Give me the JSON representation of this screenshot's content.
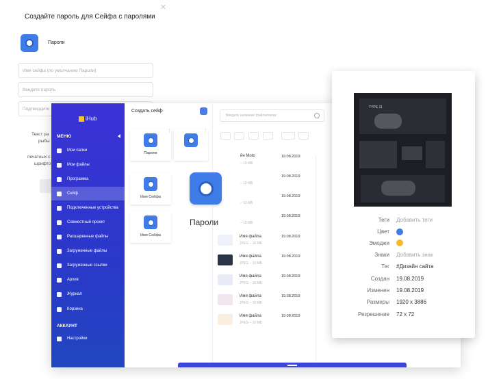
{
  "dialog": {
    "title": "Создайте пароль для Сейфа с паролями",
    "safe_name": "Пароли",
    "fields": [
      {
        "placeholder": "Имя сейфа (по умолчанию Пароли)"
      },
      {
        "placeholder": "Введите пароль"
      },
      {
        "placeholder": "Подтвердите"
      }
    ],
    "text_lines": [
      "Текст ра",
      "рыбы",
      "печатных с",
      "шрифто"
    ]
  },
  "app": {
    "logo": "iHub",
    "menu_title": "МЕНЮ",
    "nav": [
      {
        "label": "Мои папки",
        "icon": "folder-icon"
      },
      {
        "label": "Мои файлы",
        "icon": "file-icon"
      },
      {
        "label": "Программа",
        "icon": "rocket-icon"
      },
      {
        "label": "Сейф",
        "icon": "safe-icon",
        "active": true
      },
      {
        "label": "Подключенные устройства",
        "icon": "monitor-icon"
      },
      {
        "label": "Совместный проект",
        "icon": "team-icon"
      },
      {
        "label": "Расшаренные файлы",
        "icon": "share-icon"
      },
      {
        "label": "Загруженные файлы",
        "icon": "upload-icon"
      },
      {
        "label": "Загруженные ссылки",
        "icon": "link-icon"
      },
      {
        "label": "Архив",
        "icon": "archive-icon"
      },
      {
        "label": "Журнал",
        "icon": "clock-icon"
      },
      {
        "label": "Корзина",
        "icon": "trash-icon"
      }
    ],
    "account_title": "АККАУНТ",
    "settings_label": "Настройки",
    "create_safe_label": "Создать сейф",
    "safes": [
      {
        "label": "Пароли"
      },
      {
        "label": ""
      },
      {
        "label": "Имя Сейфа"
      },
      {
        "label": "Имя Сейфа"
      }
    ],
    "big_safe_label": "Пароли",
    "search_placeholder": "Введите название файла/папки",
    "files": [
      {
        "name": "йн Moto",
        "sub": "– 10 МБ",
        "date": "19.08.2019"
      },
      {
        "name": "",
        "sub": "– 10 МБ",
        "date": "19.08.2019"
      },
      {
        "name": "",
        "sub": "– 10 МБ",
        "date": "19.08.2019"
      },
      {
        "name": "",
        "sub": "– 10 МБ",
        "date": "19.08.2019"
      },
      {
        "name": "Имя файла",
        "sub": "JPEG – 10 МБ",
        "date": "19.08.2019"
      },
      {
        "name": "Имя файла",
        "sub": "JPEG – 10 МБ",
        "date": "19.08.2019"
      },
      {
        "name": "Имя файла",
        "sub": "JPEG – 10 МБ",
        "date": "19.08.2019"
      },
      {
        "name": "Имя файла",
        "sub": "JPEG – 10 МБ",
        "date": "19.08.2019"
      },
      {
        "name": "Имя файла",
        "sub": "JPEG – 10 МБ",
        "date": "19.08.2019"
      }
    ]
  },
  "details": {
    "preview_title": "TYPE 11",
    "rows": [
      {
        "key": "Теги",
        "value": "Добавить теги",
        "muted": true
      },
      {
        "key": "Цвет",
        "value": ""
      },
      {
        "key": "Эмоджи",
        "value": ""
      },
      {
        "key": "Знаки",
        "value": "Добавить знак",
        "muted": true
      },
      {
        "key": "Тег",
        "value": "#Дизайн сайта"
      },
      {
        "key": "Создан",
        "value": "19.08.2019"
      },
      {
        "key": "Изменен",
        "value": "19.08.2019"
      },
      {
        "key": "Размеры",
        "value": "1920 x 3886"
      },
      {
        "key": "Резрешение",
        "value": "72 x 72"
      }
    ],
    "color_hex": "#3f7ce8"
  }
}
